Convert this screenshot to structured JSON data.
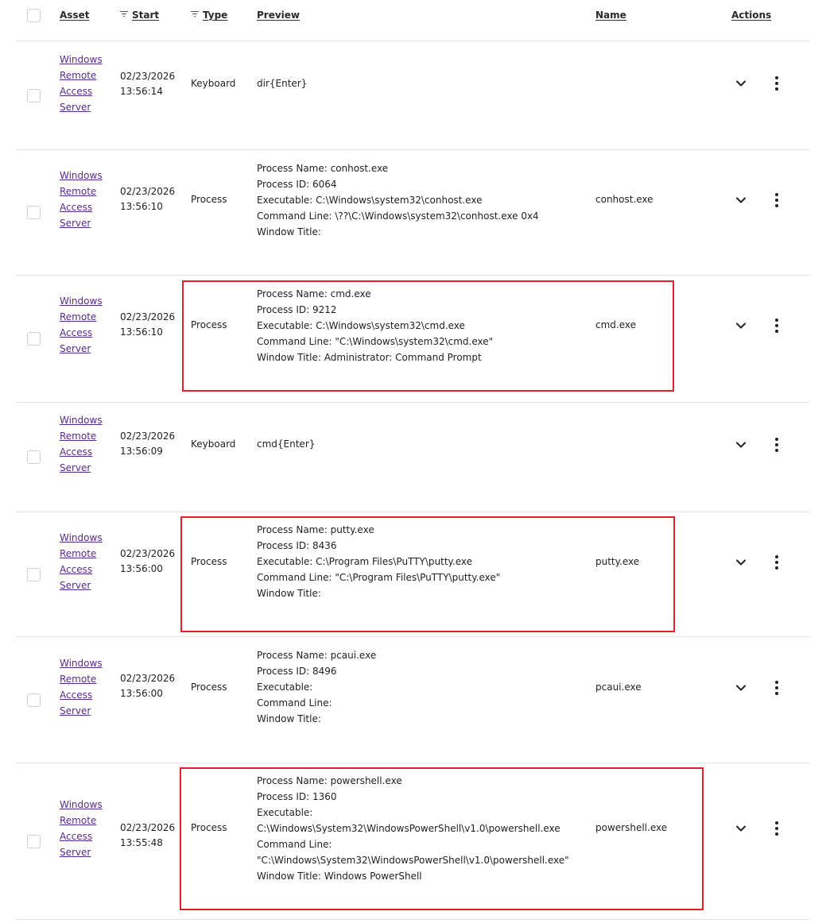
{
  "header": {
    "asset": "Asset",
    "start": "Start",
    "type": "Type",
    "preview": "Preview",
    "name": "Name",
    "actions": "Actions"
  },
  "rows": [
    {
      "asset": [
        "Windows",
        "Remote",
        "Access",
        "Server"
      ],
      "date": "02/23/2026",
      "time": "13:56:14",
      "type": "Keyboard",
      "preview": [
        "dir{Enter}"
      ],
      "name": ""
    },
    {
      "asset": [
        "Windows",
        "Remote",
        "Access",
        "Server"
      ],
      "date": "02/23/2026",
      "time": "13:56:10",
      "type": "Process",
      "preview": [
        "Process Name: conhost.exe",
        "Process ID: 6064",
        "Executable: C:\\Windows\\system32\\conhost.exe",
        "Command Line: \\??\\C:\\Windows\\system32\\conhost.exe 0x4",
        "Window Title:"
      ],
      "name": "conhost.exe"
    },
    {
      "asset": [
        "Windows",
        "Remote",
        "Access",
        "Server"
      ],
      "date": "02/23/2026",
      "time": "13:56:10",
      "type": "Process",
      "preview": [
        "Process Name: cmd.exe",
        "Process ID: 9212",
        "Executable: C:\\Windows\\system32\\cmd.exe",
        "Command Line: \"C:\\Windows\\system32\\cmd.exe\"",
        "Window Title: Administrator: Command Prompt"
      ],
      "name": "cmd.exe"
    },
    {
      "asset": [
        "Windows",
        "Remote",
        "Access",
        "Server"
      ],
      "date": "02/23/2026",
      "time": "13:56:09",
      "type": "Keyboard",
      "preview": [
        "cmd{Enter}"
      ],
      "name": ""
    },
    {
      "asset": [
        "Windows",
        "Remote",
        "Access",
        "Server"
      ],
      "date": "02/23/2026",
      "time": "13:56:00",
      "type": "Process",
      "preview": [
        "Process Name: putty.exe",
        "Process ID: 8436",
        "Executable: C:\\Program Files\\PuTTY\\putty.exe",
        "Command Line: \"C:\\Program Files\\PuTTY\\putty.exe\"",
        "Window Title:"
      ],
      "name": "putty.exe"
    },
    {
      "asset": [
        "Windows",
        "Remote",
        "Access",
        "Server"
      ],
      "date": "02/23/2026",
      "time": "13:56:00",
      "type": "Process",
      "preview": [
        "Process Name: pcaui.exe",
        "Process ID: 8496",
        "Executable:",
        "Command Line:",
        "Window Title:"
      ],
      "name": "pcaui.exe"
    },
    {
      "asset": [
        "Windows",
        "Remote",
        "Access",
        "Server"
      ],
      "date": "02/23/2026",
      "time": "13:55:48",
      "type": "Process",
      "preview": [
        "Process Name: powershell.exe",
        "Process ID: 1360",
        "Executable:",
        "C:\\Windows\\System32\\WindowsPowerShell\\v1.0\\powershell.exe",
        "Command Line:",
        "\"C:\\Windows\\System32\\WindowsPowerShell\\v1.0\\powershell.exe\"",
        "Window Title: Windows PowerShell"
      ],
      "name": "powershell.exe"
    }
  ],
  "colors": {
    "link": "#5a2a8a",
    "highlight": "#e0202a",
    "divider": "#e4e4e4"
  }
}
